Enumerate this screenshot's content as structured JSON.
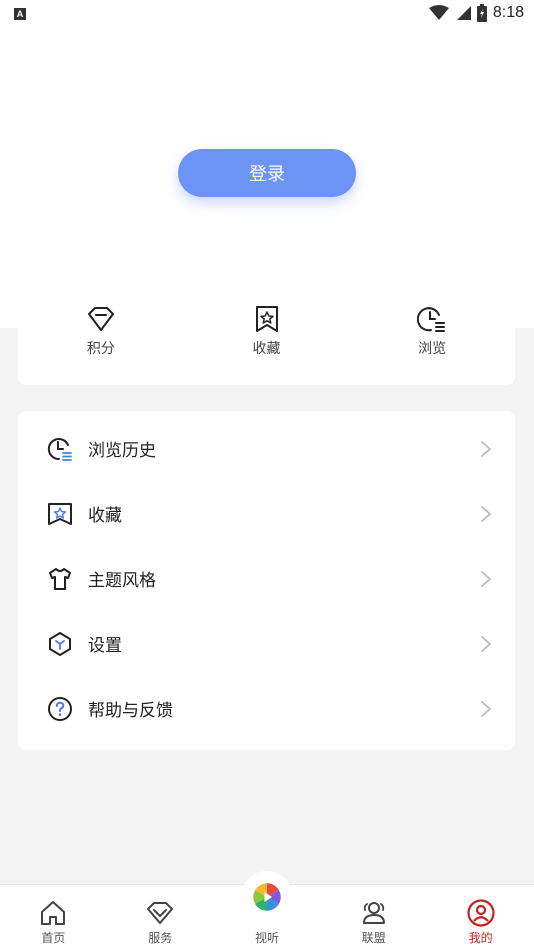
{
  "status_bar": {
    "indicator": "A",
    "time": "8:18"
  },
  "header": {
    "login_label": "登录"
  },
  "stats": [
    {
      "icon": "gem-icon",
      "label": "积分"
    },
    {
      "icon": "bookmark-star-icon",
      "label": "收藏"
    },
    {
      "icon": "clock-list-icon",
      "label": "浏览"
    }
  ],
  "menu": [
    {
      "icon": "history-icon",
      "label": "浏览历史"
    },
    {
      "icon": "bookmark-star-icon",
      "label": "收藏"
    },
    {
      "icon": "tshirt-icon",
      "label": "主题风格"
    },
    {
      "icon": "settings-hexagon-icon",
      "label": "设置"
    },
    {
      "icon": "help-icon",
      "label": "帮助与反馈"
    }
  ],
  "bottom_nav": [
    {
      "icon": "home-icon",
      "label": "首页"
    },
    {
      "icon": "diamond-icon",
      "label": "服务"
    },
    {
      "icon": "shutter-logo-icon",
      "label": "视听"
    },
    {
      "icon": "people-icon",
      "label": "联盟"
    },
    {
      "icon": "user-circle-icon",
      "label": "我的",
      "active": true
    }
  ],
  "colors": {
    "accent": "#6d93f6",
    "active_nav": "#c0231f",
    "icon": "#222222"
  }
}
